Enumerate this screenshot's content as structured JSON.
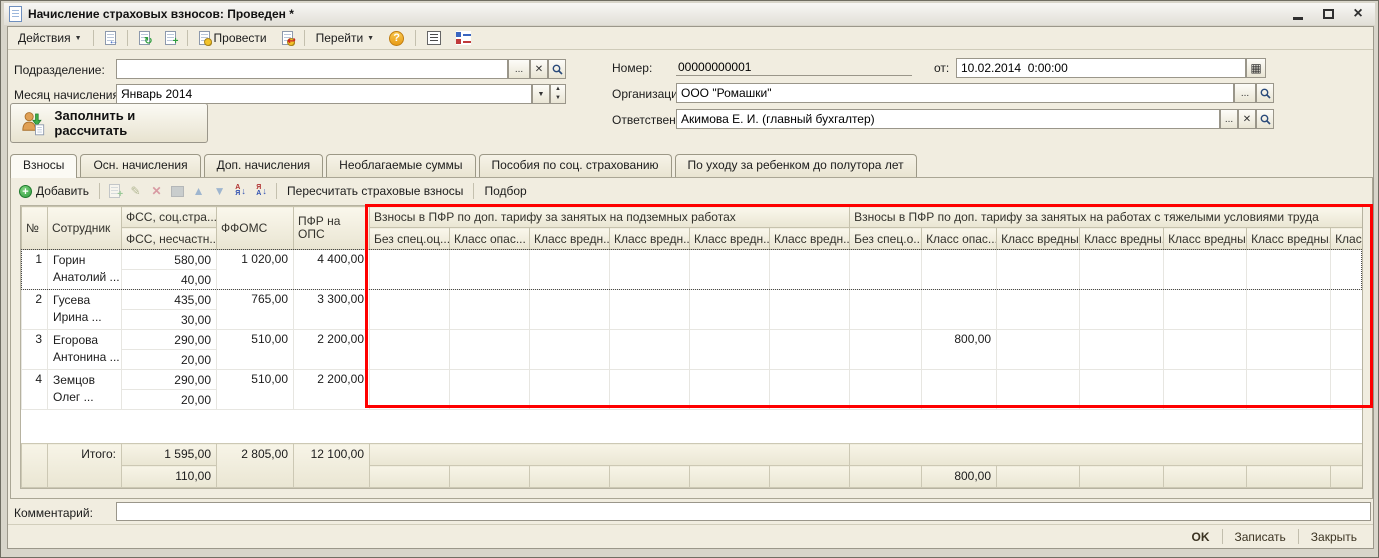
{
  "window": {
    "title": "Начисление страховых взносов: Проведен *"
  },
  "main_toolbar": {
    "actions": "Действия",
    "post": "Провести",
    "goto": "Перейти"
  },
  "form": {
    "department_label": "Подразделение:",
    "department_value": "",
    "month_label": "Месяц начисления:",
    "month_value": "Январь 2014",
    "fill_button": "Заполнить и рассчитать",
    "number_label": "Номер:",
    "number_value": "00000000001",
    "date_label": "от:",
    "date_value": "10.02.2014  0:00:00",
    "org_label": "Организация:",
    "org_value": "ООО \"Ромашки\"",
    "resp_label": "Ответственный:",
    "resp_value": "Акимова Е. И. (главный бухгалтер)"
  },
  "tabs": [
    {
      "label": "Взносы"
    },
    {
      "label": "Осн. начисления"
    },
    {
      "label": "Доп. начисления"
    },
    {
      "label": "Необлагаемые суммы"
    },
    {
      "label": "Пособия по соц. страхованию"
    },
    {
      "label": "По уходу за ребенком до полутора лет"
    }
  ],
  "table_toolbar": {
    "add": "Добавить",
    "recalc": "Пересчитать страховые взносы",
    "pick": "Подбор"
  },
  "table": {
    "headers": {
      "num": "№",
      "employee": "Сотрудник",
      "fss_social": "ФСС, соц.стра...",
      "fss_accident": "ФСС, несчастн...",
      "ffoms": "ФФОМС",
      "pfr_ops": "ПФР на ОПС",
      "group1": {
        "title": "Взносы в ПФР по доп. тарифу за занятых на подземных работах",
        "cols": [
          "Без спец.оц...",
          "Класс опас...",
          "Класс вредн...",
          "Класс вредн...",
          "Класс вредн...",
          "Класс вредн..."
        ]
      },
      "group2": {
        "title": "Взносы в ПФР по доп. тарифу за занятых на работах с тяжелыми условиями труда",
        "cols": [
          "Без спец.о...",
          "Класс опас...",
          "Класс вредны...",
          "Класс вредны...",
          "Класс вредны...",
          "Класс вредны...",
          "Класс вредны..."
        ]
      }
    },
    "rows": [
      {
        "num": "1",
        "name1": "Горин",
        "name2": "Анатолий ...",
        "fss": "580,00",
        "fss_accident": "40,00",
        "ffoms": "1 020,00",
        "pfr": "4 400,00",
        "g2_class_danger": ""
      },
      {
        "num": "2",
        "name1": "Гусева",
        "name2": "Ирина ...",
        "fss": "435,00",
        "fss_accident": "30,00",
        "ffoms": "765,00",
        "pfr": "3 300,00",
        "g2_class_danger": ""
      },
      {
        "num": "3",
        "name1": "Егорова",
        "name2": "Антонина ...",
        "fss": "290,00",
        "fss_accident": "20,00",
        "ffoms": "510,00",
        "pfr": "2 200,00",
        "g2_class_danger": "800,00"
      },
      {
        "num": "4",
        "name1": "Земцов",
        "name2": "Олег ...",
        "fss": "290,00",
        "fss_accident": "20,00",
        "ffoms": "510,00",
        "pfr": "2 200,00",
        "g2_class_danger": ""
      }
    ],
    "totals": {
      "label": "Итого:",
      "fss": "1 595,00",
      "fss_accident": "110,00",
      "ffoms": "2 805,00",
      "pfr": "12 100,00",
      "g2_class_danger": "800,00"
    }
  },
  "comment_label": "Комментарий:",
  "footer": {
    "ok": "OK",
    "write": "Записать",
    "close": "Закрыть"
  }
}
